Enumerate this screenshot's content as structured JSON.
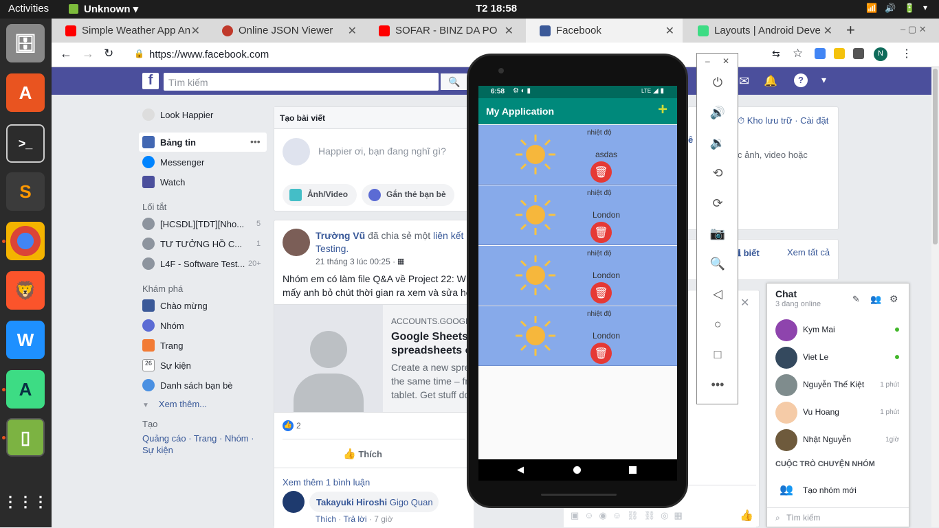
{
  "topbar": {
    "activities": "Activities",
    "app": "Unknown ▾",
    "clock": "T2 18:58"
  },
  "tabs": [
    {
      "title": "Simple Weather App An",
      "color": "#ff0000"
    },
    {
      "title": "Online JSON Viewer",
      "color": "#c0392b"
    },
    {
      "title": "SOFAR - BINZ DA PO",
      "color": "#ff0000"
    },
    {
      "title": "Facebook",
      "color": "#3b5998"
    },
    {
      "title": "Layouts | Android Deve",
      "color": "#3ddc84"
    }
  ],
  "address": {
    "url": "https://www.facebook.com",
    "profile_initial": "N"
  },
  "fb": {
    "search_placeholder": "Tìm kiếm",
    "profile": "Look Happier",
    "nav": [
      "Bảng tin",
      "Messenger",
      "Watch"
    ],
    "shortcuts_title": "Lối tắt",
    "shortcuts": [
      {
        "name": "[HCSDL][TDT][Nho...",
        "count": "5"
      },
      {
        "name": "TƯ TƯỞNG HỒ C...",
        "count": "1"
      },
      {
        "name": "L4F - Software Test...",
        "count": "20+"
      }
    ],
    "explore_title": "Khám phá",
    "explore": [
      "Chào mừng",
      "Nhóm",
      "Trang",
      "Sự kiện",
      "Danh sách bạn bè"
    ],
    "see_more": "Xem thêm...",
    "create_title": "Tạo",
    "create_links": "Quảng cáo · Trang · Nhóm · Sự kiện",
    "composer": {
      "title": "Tạo bài viết",
      "placeholder": "Happier ơi, bạn đang nghĩ gì?",
      "photo": "Ảnh/Video",
      "tag": "Gắn thẻ bạn bè"
    },
    "post": {
      "author": "Trường Vũ",
      "shared": "đã chia sẻ một",
      "link": "liên kết",
      "group": "Testing.",
      "time": "21 tháng 3 lúc 00:25 ·",
      "text1": "Nhóm em có làm file Q&A về Project 22: W",
      "text2": "mấy anh bỏ chút thời gian ra xem và sửa he",
      "domain": "ACCOUNTS.GOOGL",
      "link_title1": "Google Sheets",
      "link_title2": "spreadsheets c",
      "desc1": "Create a new spre",
      "desc2": "the same time – fr",
      "desc3": "tablet. Get stuff do",
      "likes": "2",
      "like_btn": "Thích",
      "more_comments": "Xem thêm 1 bình luận",
      "commenter": "Takayuki Hiroshi",
      "comment": "Gigo Quan",
      "c_like": "Thích",
      "c_reply": "Trả lời",
      "c_time": "7 giờ"
    },
    "right": {
      "archive": "Kho lưu trữ · Cài đặt",
      "frag1": "c ảnh, video hoặc",
      "frag2": "ê",
      "know": "biết",
      "see_all": "Xem tất cả"
    }
  },
  "android": {
    "status_time": "6:58",
    "status_right": "LTE",
    "app_title": "My Application",
    "add": "+",
    "rows": [
      {
        "label": "nhiệt độ",
        "city": "asdas"
      },
      {
        "label": "nhiệt độ",
        "city": "London"
      },
      {
        "label": "nhiệt độ",
        "city": "London"
      },
      {
        "label": "nhiệt độ",
        "city": "London"
      }
    ]
  },
  "chat": {
    "title": "Chat",
    "online": "3 đang online",
    "users": [
      {
        "name": "Kym Mai",
        "status": "",
        "online": true,
        "color": "#8e44ad"
      },
      {
        "name": "Viet Le",
        "status": "",
        "online": true,
        "color": "#34495e"
      },
      {
        "name": "Nguyễn Thế Kiệt",
        "status": "1 phút",
        "online": false,
        "color": "#7f8c8d"
      },
      {
        "name": "Vu Hoang",
        "status": "1 phút",
        "online": false,
        "color": "#f5cba7"
      },
      {
        "name": "Nhật Nguyễn",
        "status": "1giờ",
        "online": false,
        "color": "#6e5a3c"
      }
    ],
    "group_title": "CUỘC TRÒ CHUYỆN NHÓM",
    "new_group": "Tạo nhóm mới",
    "search": "Tìm kiếm"
  }
}
